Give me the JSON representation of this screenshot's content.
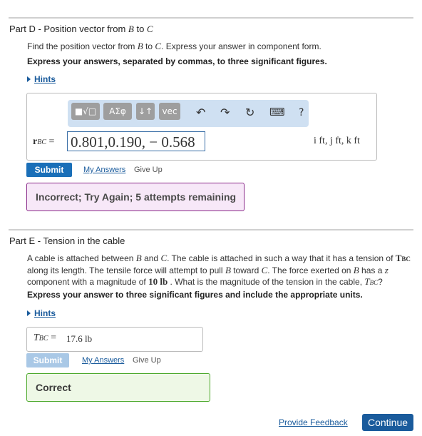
{
  "partD": {
    "label": "Part D",
    "title_prefix": " - Position vector from ",
    "from": "B",
    "to_word": " to ",
    "to": "C",
    "prompt_pre": "Find the position vector from ",
    "prompt_from": "B",
    "prompt_to_word": " to ",
    "prompt_to": "C",
    "prompt_post": ". Express your answer in component form.",
    "instruction": "Express your answers, separated by commas, to three significant figures.",
    "hints": "Hints",
    "toolbar": {
      "templates": "■√□",
      "greek": "AΣφ",
      "arrows": "↓↑",
      "vec": "vec",
      "undo": "↶",
      "redo": "↷",
      "reset": "↻",
      "keyboard": "⌨",
      "help": "?"
    },
    "answer_label": "r",
    "answer_sub": "BC",
    "answer_eq": " =",
    "answer_value": "0.801,0.190, − 0.568",
    "units": "i ft, j ft, k ft",
    "submit": "Submit",
    "my_answers": "My Answers",
    "give_up": "Give Up",
    "feedback": "Incorrect; Try Again; 5 attempts remaining"
  },
  "partE": {
    "label": "Part E",
    "title": " - Tension in the cable",
    "p1_a": "A cable is attached between ",
    "p1_b": "B",
    "p1_c": " and ",
    "p1_d": "C",
    "p1_e": ". The cable is attached in such a way that it has a tension of ",
    "p1_f": "T",
    "p1_g": "BC",
    "p2_a": "along its length. The tensile force will attempt to pull ",
    "p2_b": "B",
    "p2_c": " toward ",
    "p2_d": "C",
    "p2_e": ". The force exerted on ",
    "p2_f": "B",
    "p2_g": " has a ",
    "p2_h": "z",
    "p3_a": "component with a magnitude of ",
    "p3_b": "10 lb",
    "p3_c": " . What is the magnitude of the tension in the cable, ",
    "p3_d": "T",
    "p3_e": "BC",
    "p3_f": "?",
    "instruction": "Express your answer to three significant figures and include the appropriate units.",
    "hints": "Hints",
    "answer_label": "T",
    "answer_sub": "BC",
    "answer_eq": " =",
    "answer_value": "17.6 lb",
    "submit": "Submit",
    "my_answers": "My Answers",
    "give_up": "Give Up",
    "feedback": "Correct"
  },
  "footer": {
    "provide_feedback": "Provide Feedback",
    "continue": "Continue"
  }
}
